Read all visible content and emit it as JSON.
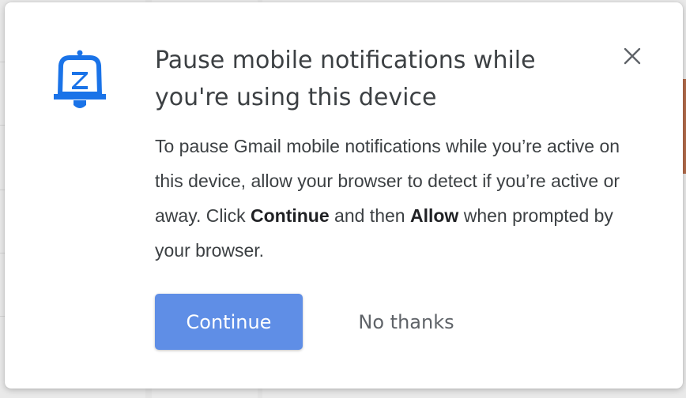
{
  "dialog": {
    "title": "Pause mobile notifications while you're using this device",
    "body": {
      "part1": "To pause Gmail mobile notifications while you’re active on this device, allow your browser to detect if you’re active or away. Click ",
      "continue_emphasis": "Continue",
      "part2": " and then ",
      "allow_emphasis": "Allow",
      "part3": " when prompted by your browser."
    },
    "continue_label": "Continue",
    "no_thanks_label": "No thanks",
    "icons": {
      "header": "snooze-bell-icon",
      "close": "close-icon"
    },
    "colors": {
      "accent": "#1a73e8",
      "button": "#5f8ee6",
      "text": "#3c4043"
    }
  }
}
